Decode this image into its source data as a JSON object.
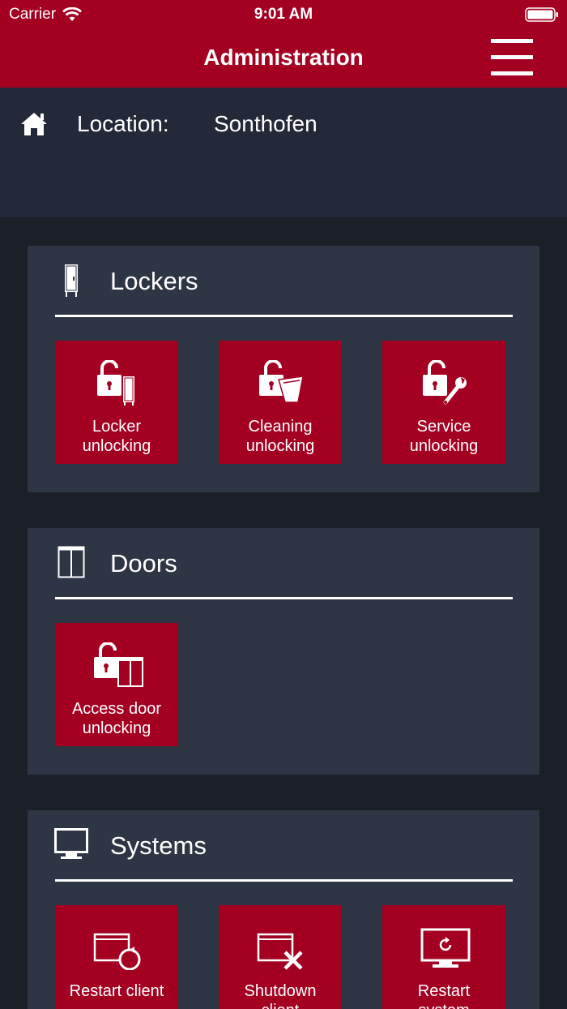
{
  "status_bar": {
    "carrier": "Carrier",
    "time": "9:01 AM"
  },
  "nav": {
    "title": "Administration",
    "menu_icon": "hamburger-menu-icon"
  },
  "location": {
    "label": "Location:",
    "value": "Sonthofen",
    "icon": "home-icon"
  },
  "sections": {
    "lockers": {
      "title": "Lockers",
      "icon": "locker-icon",
      "tiles": [
        {
          "label": "Locker\nunlocking",
          "icon": "locker-unlock-icon"
        },
        {
          "label": "Cleaning\nunlocking",
          "icon": "cleaning-unlock-icon"
        },
        {
          "label": "Service\nunlocking",
          "icon": "service-unlock-icon"
        }
      ]
    },
    "doors": {
      "title": "Doors",
      "icon": "door-icon",
      "tiles": [
        {
          "label": "Access door\nunlocking",
          "icon": "access-door-unlock-icon"
        }
      ]
    },
    "systems": {
      "title": "Systems",
      "icon": "monitor-icon",
      "tiles": [
        {
          "label": "Restart client",
          "icon": "restart-client-icon"
        },
        {
          "label": "Shutdown\nclient",
          "icon": "shutdown-client-icon"
        },
        {
          "label": "Restart\nsystem",
          "icon": "restart-system-icon"
        }
      ]
    }
  },
  "colors": {
    "brand_red": "#a30022",
    "background": "#1b1f27",
    "header_band": "#232938",
    "card": "#2e3544"
  }
}
